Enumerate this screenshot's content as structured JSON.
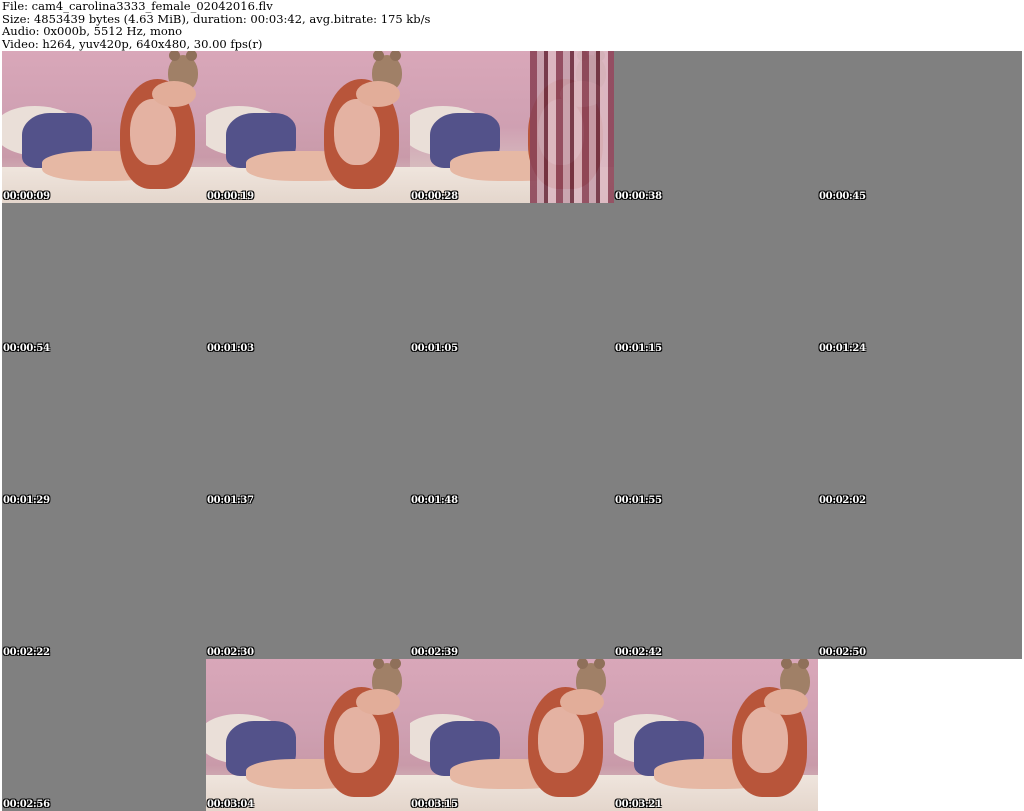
{
  "header": {
    "file_line": "File: cam4_carolina3333_female_02042016.flv",
    "size_line": "Size: 4853439 bytes (4.63 MiB), duration: 00:03:42, avg.bitrate: 175 kb/s",
    "audio_line": "Audio: 0x000b, 5512 Hz, mono",
    "video_line": "Video: h264, yuv420p, 640x480, 30.00 fps(r)"
  },
  "thumbnails": [
    {
      "timestamp": "00:00:09",
      "frame": "image"
    },
    {
      "timestamp": "00:00:19",
      "frame": "image"
    },
    {
      "timestamp": "00:00:28",
      "frame": "image-glitched"
    },
    {
      "timestamp": "00:00:38",
      "frame": "gray"
    },
    {
      "timestamp": "00:00:45",
      "frame": "gray"
    },
    {
      "timestamp": "00:00:54",
      "frame": "gray"
    },
    {
      "timestamp": "00:01:03",
      "frame": "gray"
    },
    {
      "timestamp": "00:01:05",
      "frame": "gray"
    },
    {
      "timestamp": "00:01:15",
      "frame": "gray"
    },
    {
      "timestamp": "00:01:24",
      "frame": "gray"
    },
    {
      "timestamp": "00:01:29",
      "frame": "gray"
    },
    {
      "timestamp": "00:01:37",
      "frame": "gray"
    },
    {
      "timestamp": "00:01:48",
      "frame": "gray"
    },
    {
      "timestamp": "00:01:55",
      "frame": "gray"
    },
    {
      "timestamp": "00:02:02",
      "frame": "gray"
    },
    {
      "timestamp": "00:02:22",
      "frame": "gray"
    },
    {
      "timestamp": "00:02:30",
      "frame": "gray"
    },
    {
      "timestamp": "00:02:39",
      "frame": "gray"
    },
    {
      "timestamp": "00:02:42",
      "frame": "gray"
    },
    {
      "timestamp": "00:02:50",
      "frame": "gray"
    },
    {
      "timestamp": "00:02:56",
      "frame": "gray"
    },
    {
      "timestamp": "00:03:04",
      "frame": "image"
    },
    {
      "timestamp": "00:03:15",
      "frame": "image"
    },
    {
      "timestamp": "00:03:21",
      "frame": "image"
    },
    {
      "timestamp": "",
      "frame": "empty"
    }
  ],
  "colors": {
    "placeholder_gray": "#808080",
    "timestamp_text": "#ffffff",
    "background": "#ffffff"
  }
}
